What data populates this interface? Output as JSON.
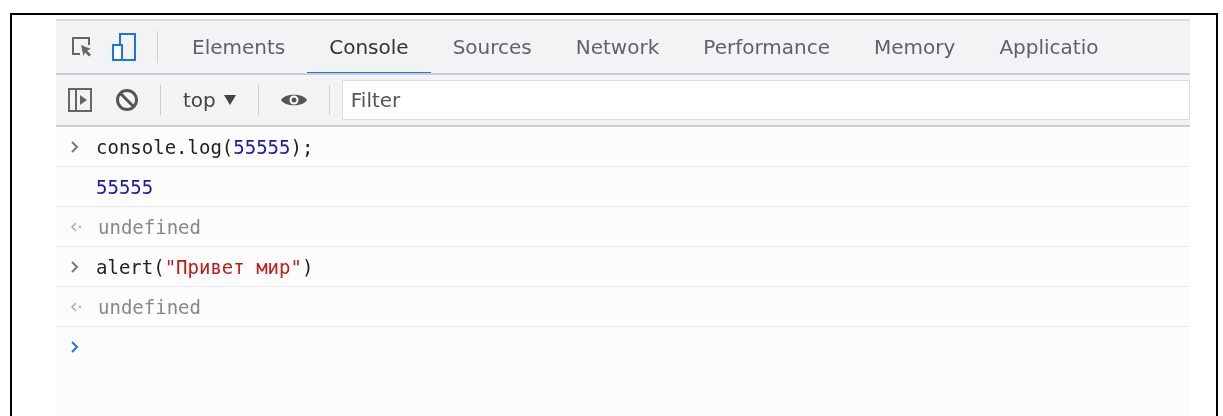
{
  "tabs": [
    {
      "label": "Elements",
      "selected": false
    },
    {
      "label": "Console",
      "selected": true
    },
    {
      "label": "Sources",
      "selected": false
    },
    {
      "label": "Network",
      "selected": false
    },
    {
      "label": "Performance",
      "selected": false
    },
    {
      "label": "Memory",
      "selected": false
    },
    {
      "label": "Applicatio",
      "selected": false
    }
  ],
  "toolbar": {
    "context": "top",
    "filter": {
      "placeholder": "Filter"
    }
  },
  "console": [
    {
      "kind": "input",
      "tokens": [
        {
          "kind": "plain",
          "text": "console.log("
        },
        {
          "kind": "number",
          "text": "55555"
        },
        {
          "kind": "plain",
          "text": ");"
        }
      ]
    },
    {
      "kind": "log",
      "tokens": [
        {
          "kind": "number",
          "text": "55555"
        }
      ]
    },
    {
      "kind": "result",
      "tokens": [
        {
          "kind": "undefined",
          "text": "undefined"
        }
      ]
    },
    {
      "kind": "input",
      "tokens": [
        {
          "kind": "plain",
          "text": "alert("
        },
        {
          "kind": "string",
          "text": "\"Привет мир\""
        },
        {
          "kind": "plain",
          "text": ")"
        }
      ]
    },
    {
      "kind": "result",
      "tokens": [
        {
          "kind": "undefined",
          "text": "undefined"
        }
      ]
    },
    {
      "kind": "prompt"
    }
  ]
}
